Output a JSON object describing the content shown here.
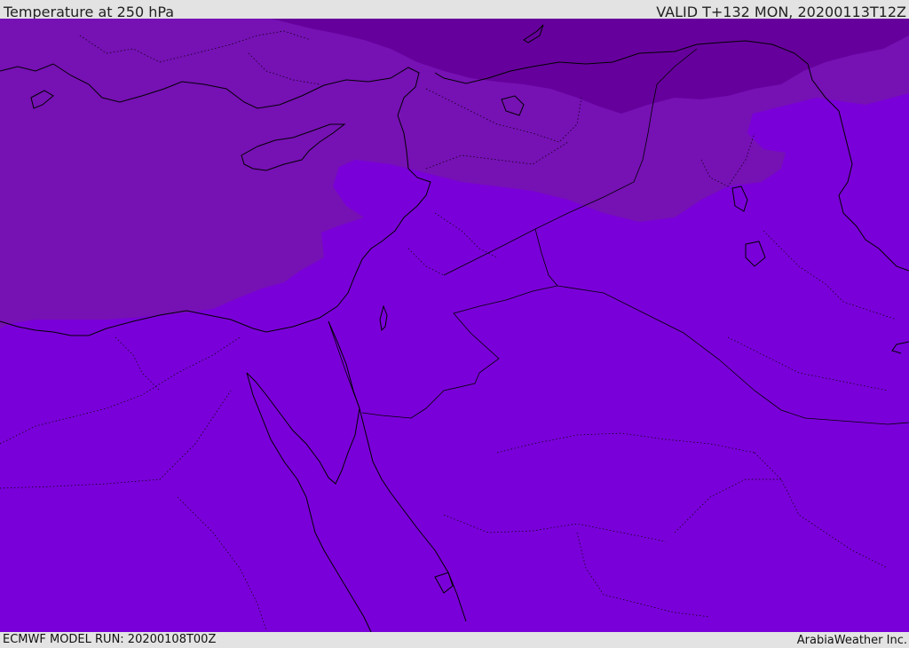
{
  "header": {
    "title": "Temperature at 250 hPa",
    "valid": "VALID T+132 MON, 20200113T12Z"
  },
  "footer": {
    "model_run": "ECMWF MODEL RUN: 20200108T00Z",
    "credit": "ArabiaWeather Inc."
  },
  "map": {
    "colors": {
      "dark_band": "#66009c",
      "mid_band": "#7611b4",
      "main_band": "#7a00d9",
      "coastline": "#000000"
    }
  }
}
